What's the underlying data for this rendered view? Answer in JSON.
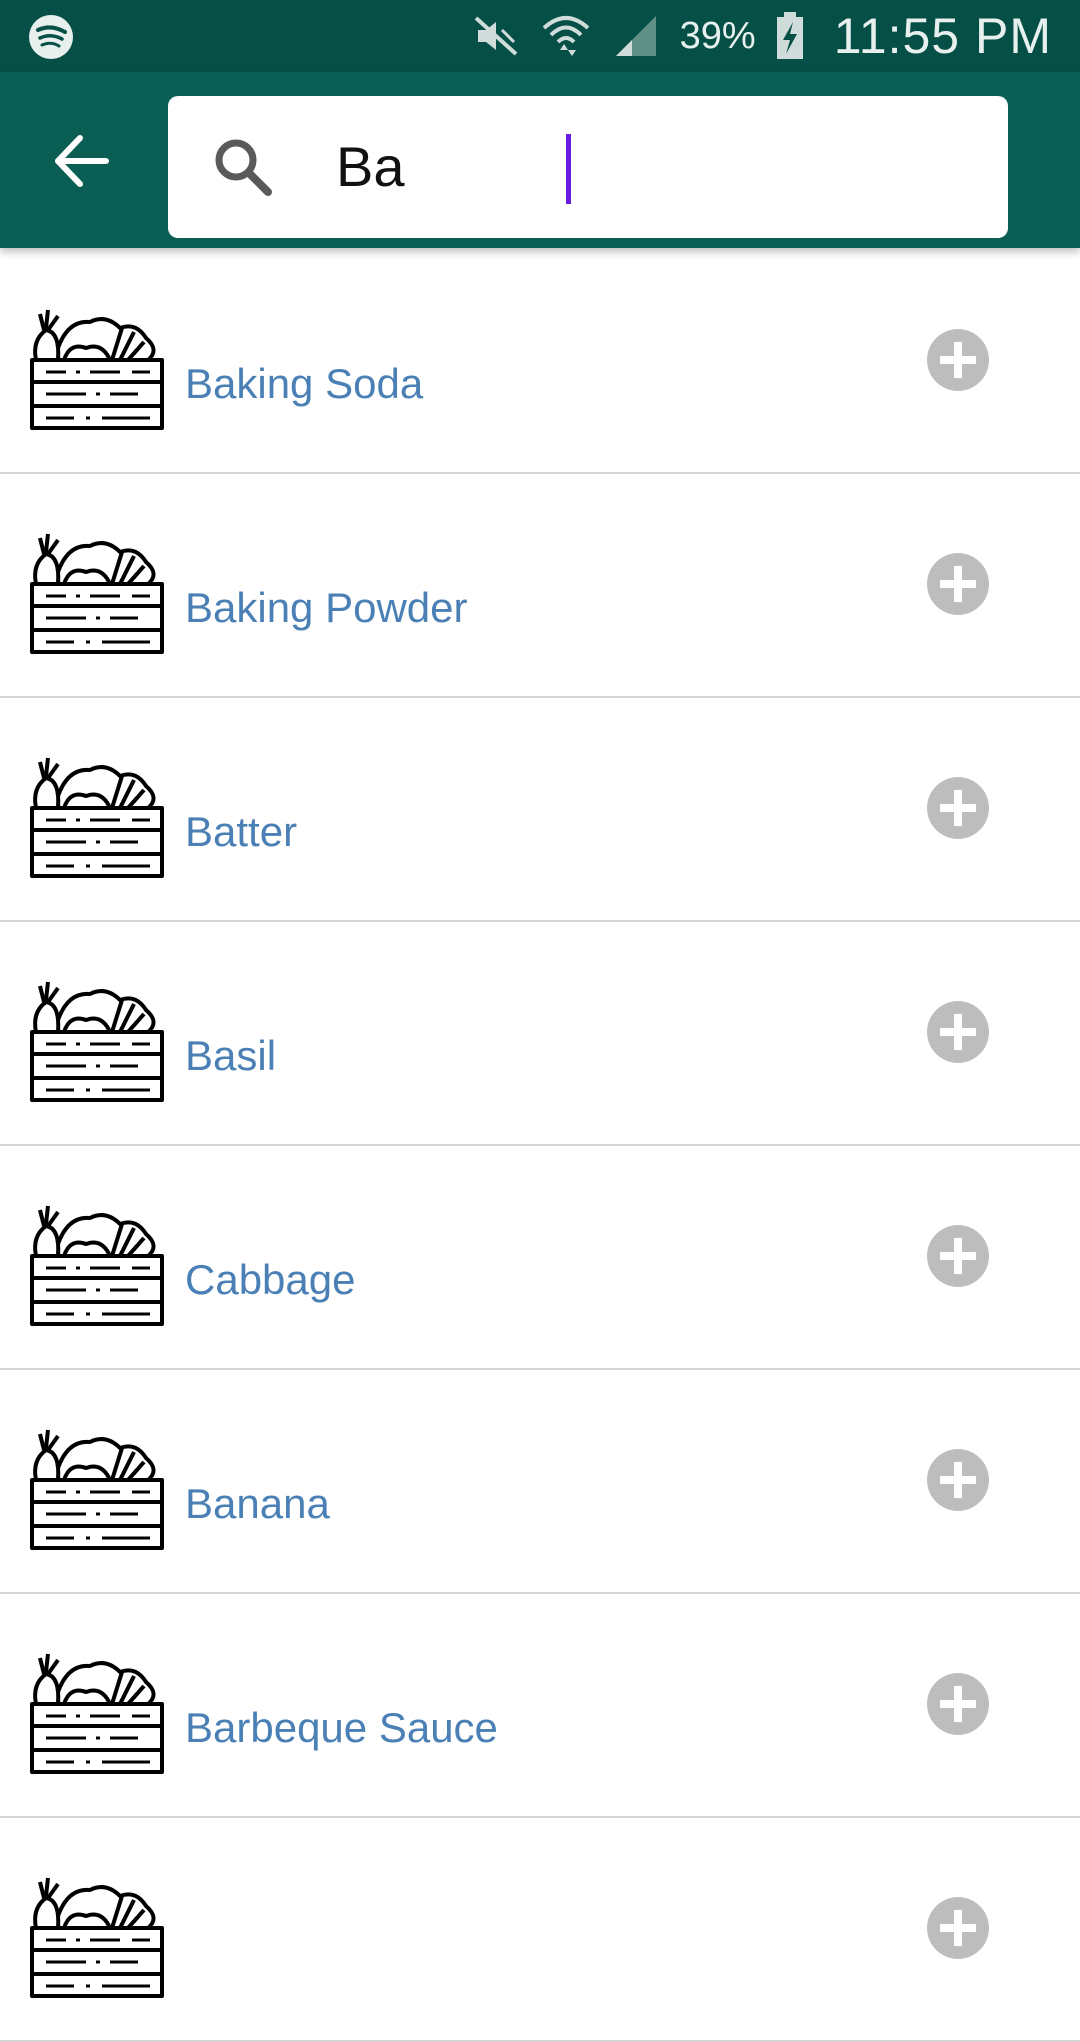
{
  "status_bar": {
    "battery_percent": "39%",
    "time": "11:55 PM"
  },
  "search": {
    "value": "Ba",
    "placeholder": ""
  },
  "results": [
    {
      "label": "Baking Soda"
    },
    {
      "label": "Baking Powder"
    },
    {
      "label": "Batter"
    },
    {
      "label": "Basil"
    },
    {
      "label": "Cabbage"
    },
    {
      "label": "Banana"
    },
    {
      "label": "Barbeque Sauce"
    },
    {
      "label": ""
    }
  ],
  "icons": {
    "back": "arrow-left-icon",
    "search": "search-icon",
    "item": "vegetable-crate-icon",
    "add": "plus-circle-icon"
  },
  "colors": {
    "status_bar": "#064f46",
    "app_bar": "#0a5e54",
    "item_text": "#4a80b5",
    "add_icon": "#bdbdbd",
    "caret": "#6a1be0"
  }
}
